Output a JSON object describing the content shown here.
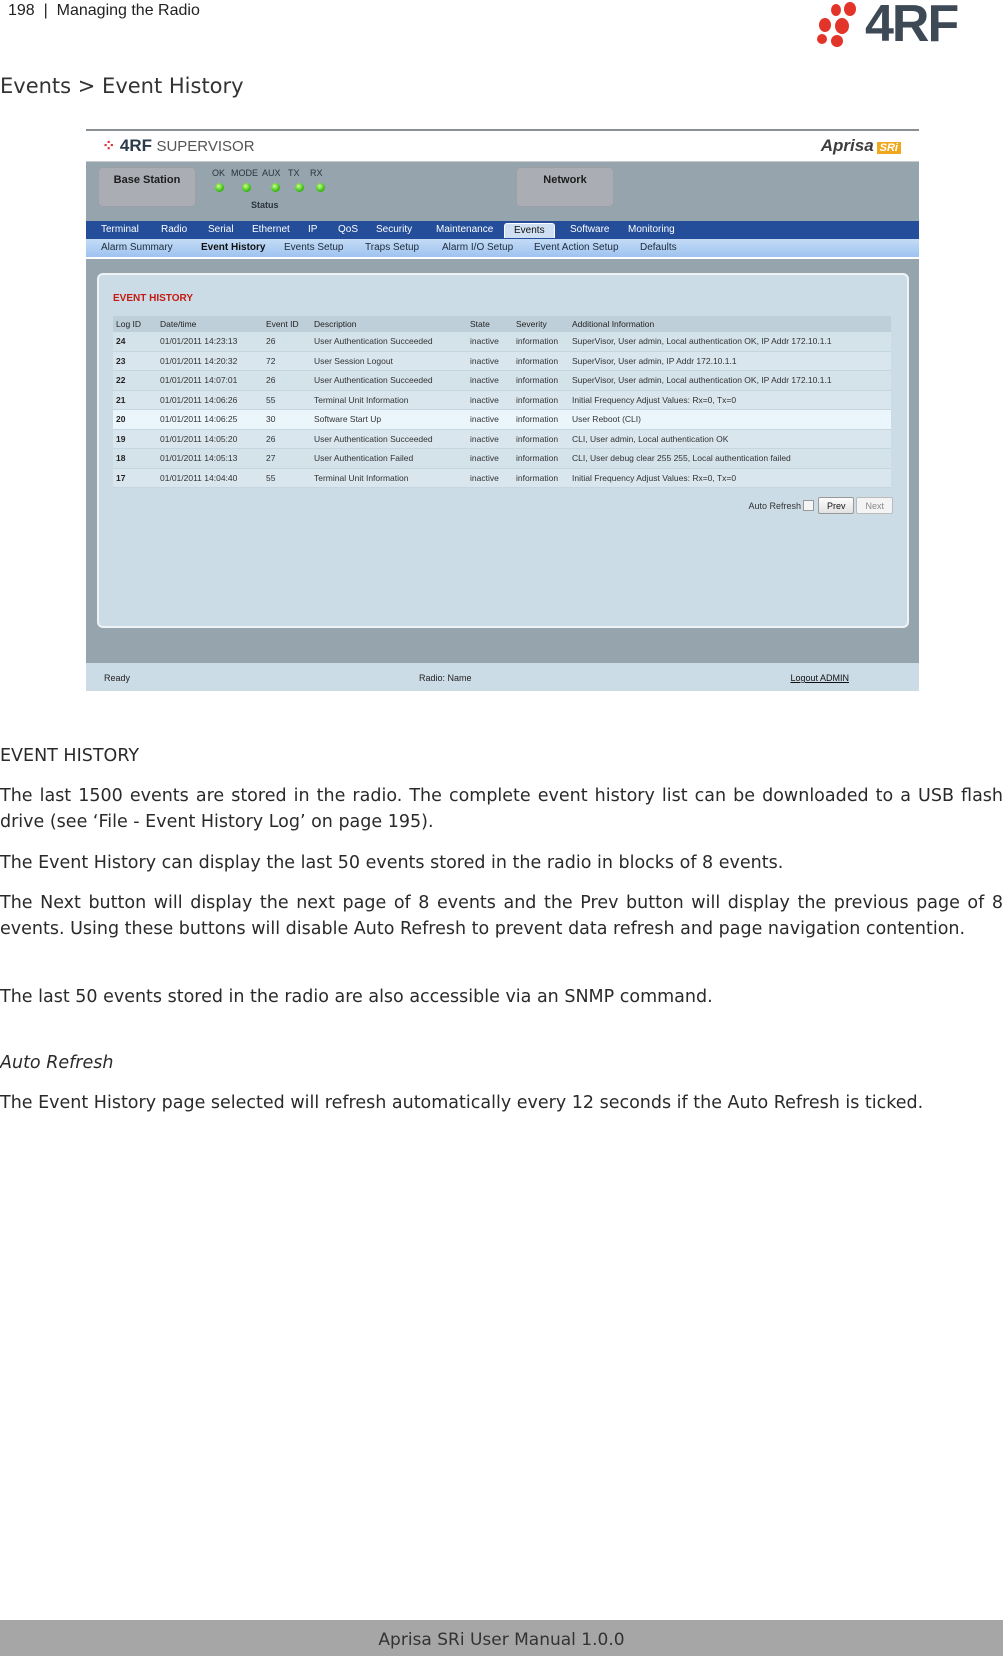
{
  "page_header": {
    "page_number": "198",
    "separator": "|",
    "chapter": "Managing the Radio"
  },
  "brand": {
    "logo_text": "4RF",
    "dot_color": "#e3342a",
    "text_color": "#3d4a55"
  },
  "section_title": "Events > Event History",
  "screenshot": {
    "titlebar": {
      "logo_brand": "4RF",
      "logo_product": "SUPERVISOR",
      "product_badge": "Aprisa",
      "product_badge_suffix": "SRi"
    },
    "status_panel": {
      "left_box": "Base Station",
      "right_box": "Network",
      "leds": [
        {
          "label": "OK",
          "state": "green"
        },
        {
          "label": "MODE",
          "state": "green"
        },
        {
          "label": "AUX",
          "state": "green"
        },
        {
          "label": "TX",
          "state": "green"
        },
        {
          "label": "RX",
          "state": "green"
        }
      ],
      "status_label": "Status"
    },
    "main_nav": [
      "Terminal",
      "Radio",
      "Serial",
      "Ethernet",
      "IP",
      "QoS",
      "Security",
      "Maintenance",
      "Events",
      "Software",
      "Monitoring"
    ],
    "main_nav_active": "Events",
    "sub_nav": [
      "Alarm Summary",
      "Event History",
      "Events Setup",
      "Traps Setup",
      "Alarm I/O Setup",
      "Event Action Setup",
      "Defaults"
    ],
    "sub_nav_active": "Event History",
    "card_title": "EVENT HISTORY",
    "table": {
      "columns": [
        "Log ID",
        "Date/time",
        "Event ID",
        "Description",
        "State",
        "Severity",
        "Additional Information"
      ],
      "rows": [
        [
          "24",
          "01/01/2011 14:23:13",
          "26",
          "User Authentication Succeeded",
          "inactive",
          "information",
          "SuperVisor, User admin, Local authentication OK, IP Addr 172.10.1.1"
        ],
        [
          "23",
          "01/01/2011 14:20:32",
          "72",
          "User Session Logout",
          "inactive",
          "information",
          "SuperVisor, User admin, IP Addr 172.10.1.1"
        ],
        [
          "22",
          "01/01/2011 14:07:01",
          "26",
          "User Authentication Succeeded",
          "inactive",
          "information",
          "SuperVisor, User admin, Local authentication OK, IP Addr 172.10.1.1"
        ],
        [
          "21",
          "01/01/2011 14:06:26",
          "55",
          "Terminal Unit Information",
          "inactive",
          "information",
          "Initial Frequency Adjust Values: Rx=0, Tx=0"
        ],
        [
          "20",
          "01/01/2011 14:06:25",
          "30",
          "Software Start Up",
          "inactive",
          "information",
          "User Reboot (CLI)"
        ],
        [
          "19",
          "01/01/2011 14:05:20",
          "26",
          "User Authentication Succeeded",
          "inactive",
          "information",
          "CLI, User admin, Local authentication OK"
        ],
        [
          "18",
          "01/01/2011 14:05:13",
          "27",
          "User Authentication Failed",
          "inactive",
          "information",
          "CLI, User debug clear 255 255, Local authentication failed"
        ],
        [
          "17",
          "01/01/2011 14:04:40",
          "55",
          "Terminal Unit Information",
          "inactive",
          "information",
          "Initial Frequency Adjust Values: Rx=0, Tx=0"
        ]
      ],
      "highlighted_row": "20"
    },
    "pager": {
      "auto_refresh_label": "Auto Refresh",
      "auto_refresh_checked": false,
      "prev_label": "Prev",
      "next_label": "Next",
      "next_disabled": true
    },
    "footer": {
      "status": "Ready",
      "radio": "Radio: Name",
      "logout": "Logout ADMIN"
    }
  },
  "body": {
    "heading": "EVENT HISTORY",
    "p1": "The last 1500 events are stored in the radio. The complete event history list can be downloaded to a USB flash drive (see ‘File - Event History Log’ on page 195).",
    "p2": "The Event History can display the last 50 events stored in the radio in blocks of 8 events.",
    "p3": "The Next button will display the next page of 8 events and the Prev button will display the previous page of 8 events. Using these buttons will disable Auto Refresh to prevent data refresh and page navigation contention.",
    "p4": "The last 50 events stored in the radio are also accessible via an SNMP command.",
    "subheading": "Auto Refresh",
    "p5": "The Event History page selected will refresh automatically every 12 seconds if the Auto Refresh is ticked."
  },
  "page_footer": "Aprisa SRi User Manual 1.0.0"
}
